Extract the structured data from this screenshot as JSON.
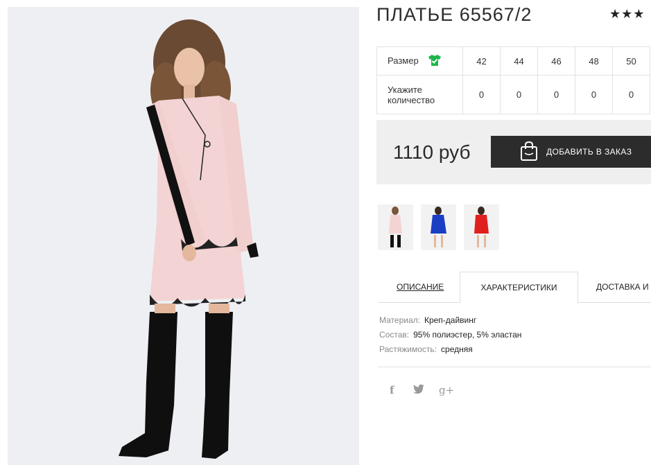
{
  "product": {
    "title": "ПЛАТЬЕ 65567/2",
    "rating_stars": "★★★"
  },
  "sizes": {
    "size_label": "Размер",
    "qty_label": "Укажите количество",
    "values": [
      "42",
      "44",
      "46",
      "48",
      "50"
    ],
    "quantities": [
      "0",
      "0",
      "0",
      "0",
      "0"
    ]
  },
  "purchase": {
    "price": "1110 руб",
    "add_button": "ДОБАВИТЬ В ЗАКАЗ"
  },
  "tabs": [
    "ОПИСАНИЕ",
    "ХАРАКТЕРИСТИКИ",
    "ДОСТАВКА И"
  ],
  "specs": [
    {
      "key": "Материал:",
      "value": "Креп-дайвинг"
    },
    {
      "key": "Состав:",
      "value": "95% полиэстер, 5% эластан"
    },
    {
      "key": "Растяжимость:",
      "value": "средняя"
    }
  ],
  "social": {
    "facebook": "f",
    "twitter": "🐦",
    "googleplus": "g+"
  },
  "colors": {
    "accent_dark": "#2c2c2c",
    "check_green": "#1db64a",
    "photo_bg": "#eeeff3",
    "dress_pink": "#f3d3d3"
  },
  "icons": [
    "check-shirt-icon",
    "shopping-bag-icon",
    "facebook-icon",
    "twitter-icon",
    "google-plus-icon"
  ]
}
